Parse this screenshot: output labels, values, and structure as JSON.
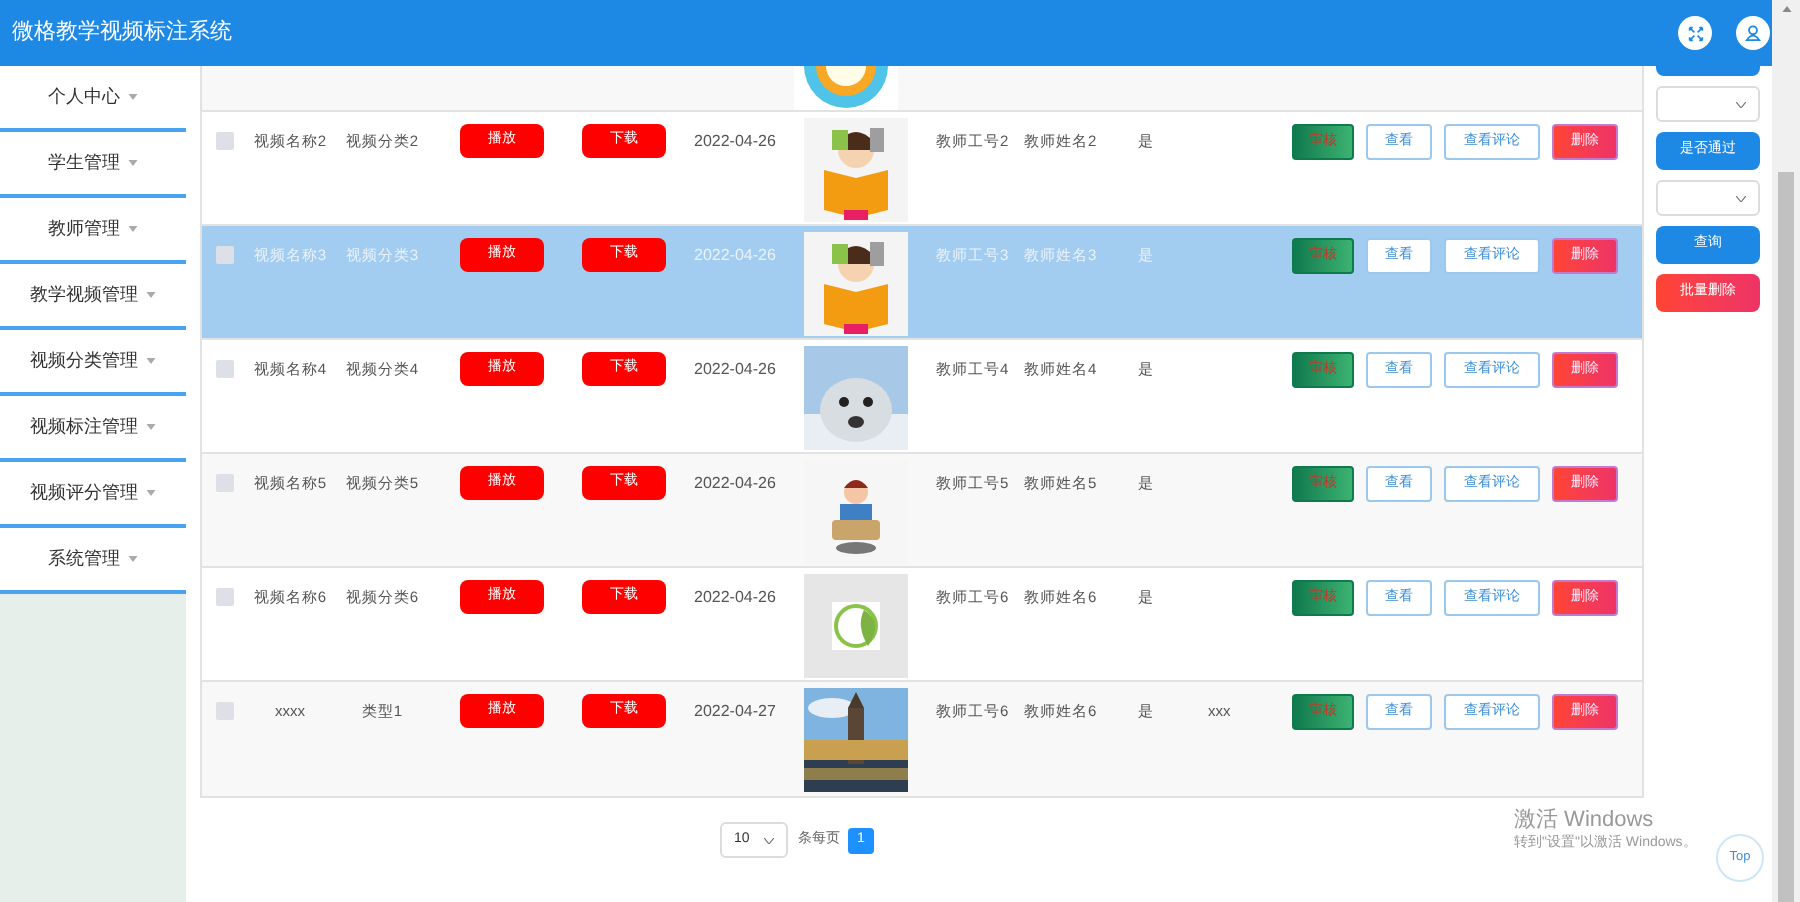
{
  "header": {
    "title": "微格教学视频标注系统"
  },
  "sidebar": {
    "items": [
      {
        "label": "个人中心"
      },
      {
        "label": "学生管理"
      },
      {
        "label": "教师管理"
      },
      {
        "label": "教学视频管理"
      },
      {
        "label": "视频分类管理"
      },
      {
        "label": "视频标注管理"
      },
      {
        "label": "视频评分管理"
      },
      {
        "label": "系统管理"
      }
    ]
  },
  "table": {
    "rows": [
      {
        "selected": false,
        "checked": false,
        "name": "视频名称2",
        "category": "视频分类2",
        "play": "播放",
        "download": "下载",
        "date": "2022-04-26",
        "teacher_id": "教师工号2",
        "teacher_name": "教师姓名2",
        "approved": "是",
        "actions": [
          "审核",
          "查看",
          "查看评论",
          "删除"
        ]
      },
      {
        "selected": true,
        "checked": false,
        "name": "视频名称3",
        "category": "视频分类3",
        "play": "播放",
        "download": "下载",
        "date": "2022-04-26",
        "teacher_id": "教师工号3",
        "teacher_name": "教师姓名3",
        "approved": "是",
        "actions": [
          "审核",
          "查看",
          "查看评论",
          "删除"
        ]
      },
      {
        "selected": false,
        "checked": false,
        "name": "视频名称4",
        "category": "视频分类4",
        "play": "播放",
        "download": "下载",
        "date": "2022-04-26",
        "teacher_id": "教师工号4",
        "teacher_name": "教师姓名4",
        "approved": "是",
        "actions": [
          "审核",
          "查看",
          "查看评论",
          "删除"
        ]
      },
      {
        "selected": false,
        "checked": false,
        "name": "视频名称5",
        "category": "视频分类5",
        "play": "播放",
        "download": "下载",
        "date": "2022-04-26",
        "teacher_id": "教师工号5",
        "teacher_name": "教师姓名5",
        "approved": "是",
        "actions": [
          "审核",
          "查看",
          "查看评论",
          "删除"
        ]
      },
      {
        "selected": false,
        "checked": false,
        "name": "视频名称6",
        "category": "视频分类6",
        "play": "播放",
        "download": "下载",
        "date": "2022-04-26",
        "teacher_id": "教师工号6",
        "teacher_name": "教师姓名6",
        "approved": "是",
        "actions": [
          "审核",
          "查看",
          "查看评论",
          "删除"
        ]
      },
      {
        "selected": false,
        "checked": false,
        "name": "xxxx",
        "category": "类型1",
        "play": "播放",
        "download": "下载",
        "date": "2022-04-27",
        "teacher_id": "教师工号6",
        "teacher_name": "教师姓名6",
        "approved": "是",
        "column_10": "xxx",
        "actions": [
          "审核",
          "查看",
          "查看评论",
          "删除"
        ]
      }
    ]
  },
  "filter_panel": {
    "approved_button": "是否通过",
    "search_button": "查询",
    "batch_delete_button": "批量删除"
  },
  "pagination": {
    "page_size": "10",
    "page_size_label": "条每页",
    "pages": [
      {
        "label": "1",
        "selected": true
      }
    ]
  },
  "os_notice": {
    "title": "激活 Windows",
    "subtitle": "转到\"设置\"以激活 Windows。"
  },
  "back_to_top": "Top"
}
